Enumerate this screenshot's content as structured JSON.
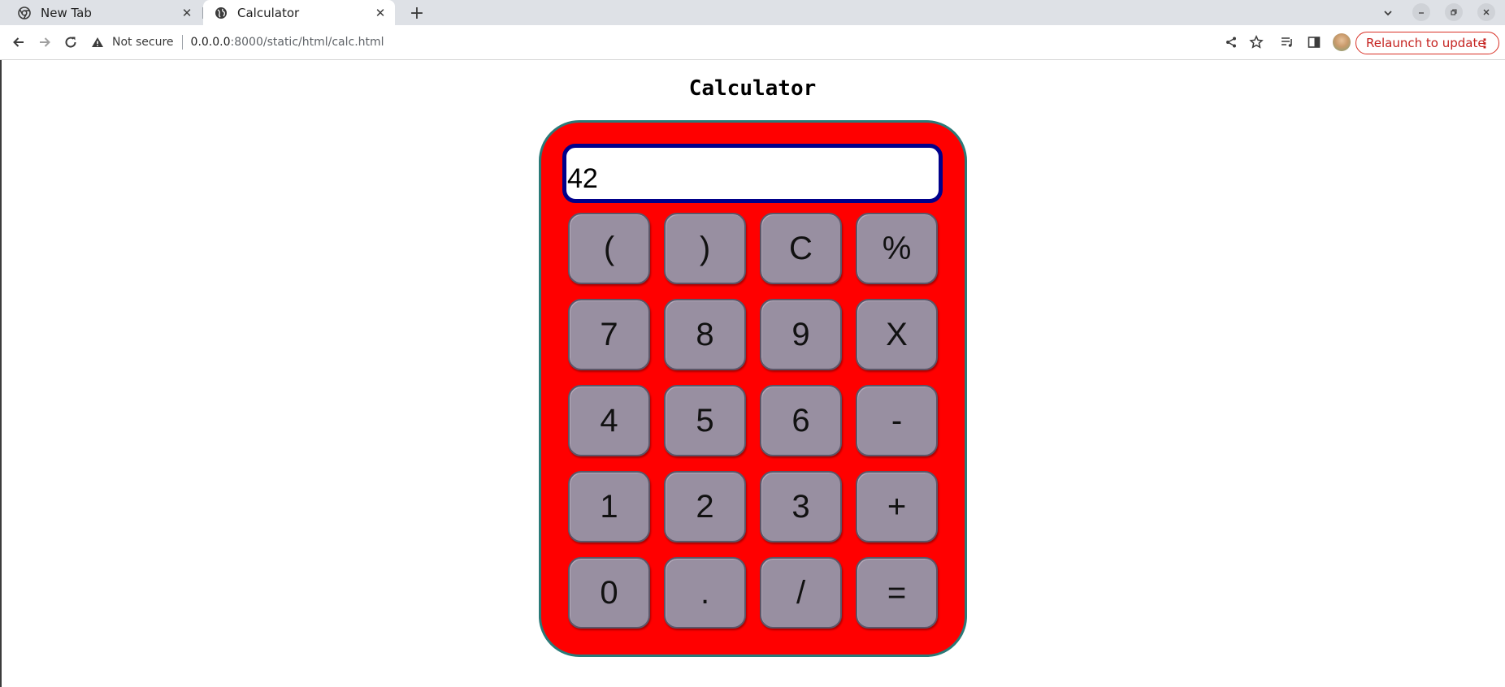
{
  "browser": {
    "tabs": [
      {
        "title": "New Tab",
        "icon": "chrome-icon",
        "active": false
      },
      {
        "title": "Calculator",
        "icon": "globe-icon",
        "active": true
      }
    ],
    "omnibox": {
      "security_label": "Not secure",
      "url_host": "0.0.0.0",
      "url_rest": ":8000/static/html/calc.html"
    },
    "relaunch_label": "Relaunch to update"
  },
  "page": {
    "title": "Calculator"
  },
  "calculator": {
    "display_value": "42",
    "colors": {
      "body": "#ff0000",
      "border": "#2b7a78",
      "display_border": "#00008b",
      "key": "#988fa1"
    },
    "keys": [
      [
        "(",
        ")",
        "C",
        "%"
      ],
      [
        "7",
        "8",
        "9",
        "X"
      ],
      [
        "4",
        "5",
        "6",
        "-"
      ],
      [
        "1",
        "2",
        "3",
        "+"
      ],
      [
        "0",
        ".",
        "/",
        "="
      ]
    ]
  }
}
